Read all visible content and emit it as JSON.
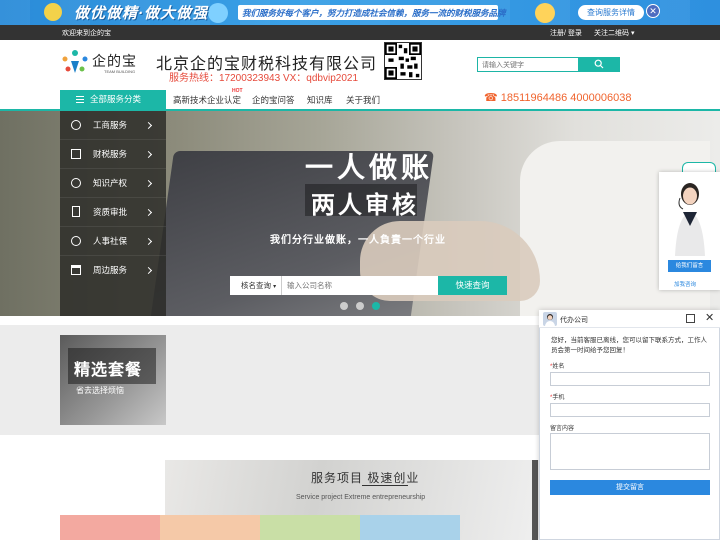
{
  "banner": {
    "title": "做优做精·做大做强",
    "slogan": "我们服务好每个客户，努力打造成社会信赖，服务一流的财税服务品牌",
    "button": "查询服务详情",
    "close": "✕"
  },
  "topbar": {
    "welcome": "欢迎来到企的宝",
    "login": "注册/ 登录",
    "qr": "关注二维码 ▾"
  },
  "header": {
    "logo_text": "企的宝",
    "logo_sub": "TEAM BUILDING",
    "company": "北京企的宝财税科技有限公司",
    "hotline": "服务热线：17200323943   VX：qdbvip2021",
    "search_placeholder": "请输入关键字"
  },
  "nav": {
    "category": "全部服务分类",
    "items": [
      "高新技术企业认定",
      "企的宝问答",
      "知识库",
      "关于我们"
    ],
    "hot": "HOT",
    "phone": "18511964486  4000006038"
  },
  "hero": {
    "line1": "一人做账",
    "line2": "两人审核",
    "line3": "我们分行业做账，一人負責一个行业"
  },
  "side_menu": {
    "items": [
      {
        "label": "工商服务",
        "icon": "user-circle-icon"
      },
      {
        "label": "财税服务",
        "icon": "ledger-icon"
      },
      {
        "label": "知识产权",
        "icon": "copyright-icon"
      },
      {
        "label": "资质审批",
        "icon": "document-icon"
      },
      {
        "label": "人事社保",
        "icon": "person-icon"
      },
      {
        "label": "周边服务",
        "icon": "building-icon"
      }
    ]
  },
  "hero_search": {
    "select": "核名查询",
    "placeholder": "输入公司名称",
    "button": "快速查询"
  },
  "package": {
    "title": "精选套餐",
    "subtitle": "省去选择烦恼"
  },
  "services": {
    "title": "服务项目 极速创业",
    "subtitle": "Service project Extreme entrepreneurship"
  },
  "float_service": {
    "button": "给我们留言",
    "link": "加我咨询"
  },
  "chat": {
    "name": "代办公司",
    "close": "✕",
    "message": "您好，当前客服已离线，您可以留下联系方式，工作人员会第一时间给予您回复！",
    "label_name": "姓名",
    "label_phone": "手机",
    "label_msg": "留言内容",
    "required": "*",
    "submit": "提交留言"
  },
  "colors": {
    "accent": "#1cb7a7",
    "phone": "#f0642e",
    "hotline": "#e64a3b",
    "chat_blue": "#2b88df"
  }
}
